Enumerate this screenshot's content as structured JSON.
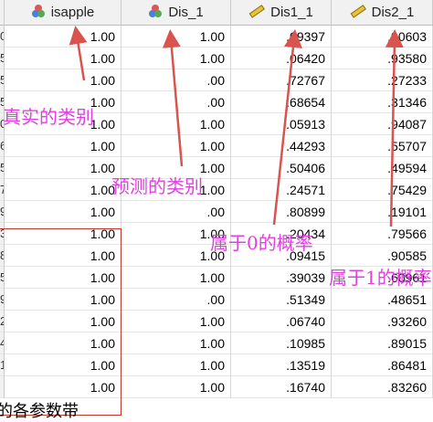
{
  "columns": [
    {
      "label": "isapple",
      "icon": "nominal-variable-icon"
    },
    {
      "label": "Dis_1",
      "icon": "nominal-variable-icon"
    },
    {
      "label": "Dis1_1",
      "icon": "scale-variable-icon"
    },
    {
      "label": "Dis2_1",
      "icon": "scale-variable-icon"
    }
  ],
  "row_header_digits": [
    "0",
    "5",
    "5",
    "5",
    "0",
    "6",
    "5",
    "7",
    "9",
    "3",
    "8",
    "5",
    "9",
    "2",
    "4",
    "1"
  ],
  "rows": [
    [
      "1.00",
      "1.00",
      ".09397",
      ".90603"
    ],
    [
      "1.00",
      "1.00",
      ".06420",
      ".93580"
    ],
    [
      "1.00",
      ".00",
      ".72767",
      ".27233"
    ],
    [
      "1.00",
      ".00",
      ".68654",
      ".31346"
    ],
    [
      "1.00",
      "1.00",
      ".05913",
      ".94087"
    ],
    [
      "1.00",
      "1.00",
      ".44293",
      ".55707"
    ],
    [
      "1.00",
      "1.00",
      ".50406",
      ".49594"
    ],
    [
      "1.00",
      "1.00",
      ".24571",
      ".75429"
    ],
    [
      "1.00",
      ".00",
      ".80899",
      ".19101"
    ],
    [
      "1.00",
      "1.00",
      ".20434",
      ".79566"
    ],
    [
      "1.00",
      "1.00",
      ".09415",
      ".90585"
    ],
    [
      "1.00",
      "1.00",
      ".39039",
      ".60961"
    ],
    [
      "1.00",
      ".00",
      ".51349",
      ".48651"
    ],
    [
      "1.00",
      "1.00",
      ".06740",
      ".93260"
    ],
    [
      "1.00",
      "1.00",
      ".10985",
      ".89015"
    ],
    [
      "1.00",
      "1.00",
      ".13519",
      ".86481"
    ],
    [
      "1.00",
      "1.00",
      ".16740",
      ".83260"
    ]
  ],
  "annotations": {
    "true_class": "真实的类别",
    "pred_class": "预测的类别",
    "prob_0": "属于0的概率",
    "prob_1": "属于1的概率",
    "bottom_text": "的各参数带"
  },
  "colors": {
    "annotation": "#e040e0",
    "arrow": "#d9534f",
    "selection": "#c0392b"
  }
}
